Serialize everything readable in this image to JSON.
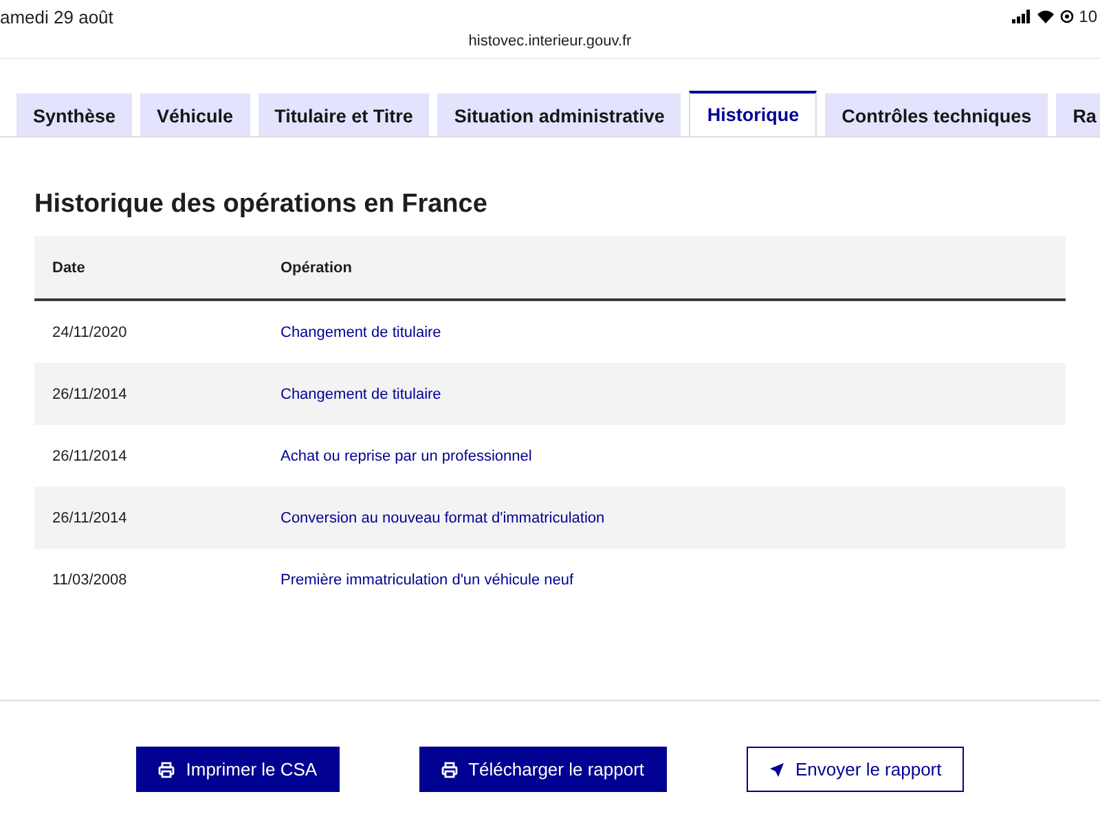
{
  "status_bar": {
    "date": "amedi 29 août",
    "url": "histovec.interieur.gouv.fr",
    "battery": "10"
  },
  "tabs": [
    {
      "label": "Synthèse",
      "selected": false
    },
    {
      "label": "Véhicule",
      "selected": false
    },
    {
      "label": "Titulaire et Titre",
      "selected": false
    },
    {
      "label": "Situation administrative",
      "selected": false
    },
    {
      "label": "Historique",
      "selected": true
    },
    {
      "label": "Contrôles techniques",
      "selected": false
    },
    {
      "label": "Ra",
      "selected": false
    }
  ],
  "section": {
    "title": "Historique des opérations en France"
  },
  "table": {
    "columns": [
      "Date",
      "Opération"
    ],
    "rows": [
      [
        "24/11/2020",
        "Changement de titulaire"
      ],
      [
        "26/11/2014",
        "Changement de titulaire"
      ],
      [
        "26/11/2014",
        "Achat ou reprise par un professionnel"
      ],
      [
        "26/11/2014",
        "Conversion au nouveau format d'immatriculation"
      ],
      [
        "11/03/2008",
        "Première immatriculation d'un véhicule neuf"
      ]
    ]
  },
  "buttons": [
    {
      "label": "Imprimer le CSA",
      "kind": "print"
    },
    {
      "label": "Télécharger le rapport",
      "kind": "print"
    },
    {
      "label": "Envoyer le rapport",
      "kind": "send"
    }
  ]
}
